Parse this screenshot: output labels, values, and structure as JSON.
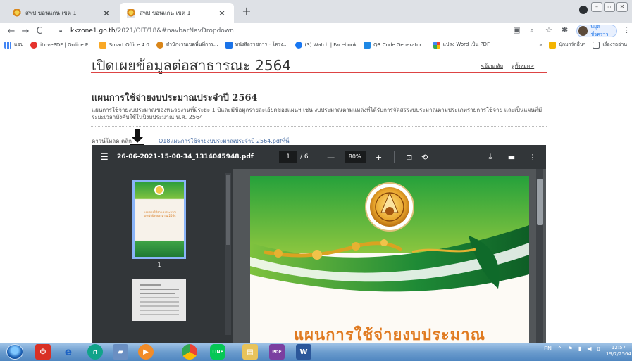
{
  "browser": {
    "tabs": [
      {
        "title": "สพป.ขอนแก่น เขต 1",
        "active": false
      },
      {
        "title": "สพป.ขอนแก่น เขต 1",
        "active": true
      }
    ],
    "new_tab": "+",
    "url_host": "kkzone1.go.th",
    "url_path": "/2021/OIT/18&#navbarNavDropdown",
    "profile_label": "หยุดชั่วคราว",
    "bookmarks": [
      {
        "label": "แอป",
        "color": "#4285f4"
      },
      {
        "label": "iLovePDF | Online P...",
        "color": "#e5322d"
      },
      {
        "label": "Smart Office 4.0",
        "color": "#f9a825"
      },
      {
        "label": "สำนักงานเขตพื้นที่การ...",
        "color": "#d9861a"
      },
      {
        "label": "หนังสือราชการ - โครง...",
        "color": "#1a73e8"
      },
      {
        "label": "(3) Watch | Facebook",
        "color": "#1877f2"
      },
      {
        "label": "QR Code Generator...",
        "color": "#1e88e5"
      },
      {
        "label": "แปลง Word เป็น PDF",
        "color": "#34a853"
      },
      {
        "label": "»",
        "color": ""
      },
      {
        "label": "บุ๊กมาร์กอื่นๆ",
        "color": "#f4b400"
      },
      {
        "label": "เรื่องรออ่าน",
        "color": "#5f6368"
      }
    ]
  },
  "page": {
    "title": "เปิดเผยข้อมูลต่อสาธารณะ 2564",
    "nav_back": "<ย้อนกลับ",
    "nav_all": "ดูทั้งหมด>",
    "section_heading": "แผนการใช้จ่ายงบประมาณประจำปี 2564",
    "description": "แผนการใช้จ่ายงบประมาณของหน่วยงานที่มีระยะ 1 ปีและมีข้อมูลรายละเอียดของแผนฯ เช่น งบประมาณตามแหล่งที่ได้รับการจัดสรรงบประมาณตามประเภทรายการใช้จ่าย และเป็นแผนที่มีระยะเวลาบังคับใช้ในปีงบประมาณ พ.ศ. 2564",
    "download_prefix": "ดาวน์โหลด คลิก",
    "download_link": "O18แผนการใช้จ่ายงบประมาณประจำปี 2564.pdfที่นี่"
  },
  "pdf": {
    "filename": "26-06-2021-15-00-34_1314045948.pdf",
    "page_current": "1",
    "page_sep": "/",
    "page_total": "6",
    "zoom_minus": "—",
    "zoom": "80%",
    "zoom_plus": "+",
    "thumb1_label": "1",
    "thumb1_text": "แผนการใช้จ่ายงบประมาณ ประจำปีงบประมาณ 2564",
    "cover_title": "แผนการใช้จ่ายงบประมาณ"
  },
  "taskbar": {
    "lang": "EN",
    "time": "12:57",
    "date": "19/7/2564"
  },
  "colors": {
    "accent_red": "#d44444",
    "pdf_toolbar": "#323639",
    "pdf_bg": "#525659",
    "cover_green": "#2e9e3e",
    "cover_orange": "#e07a20"
  }
}
